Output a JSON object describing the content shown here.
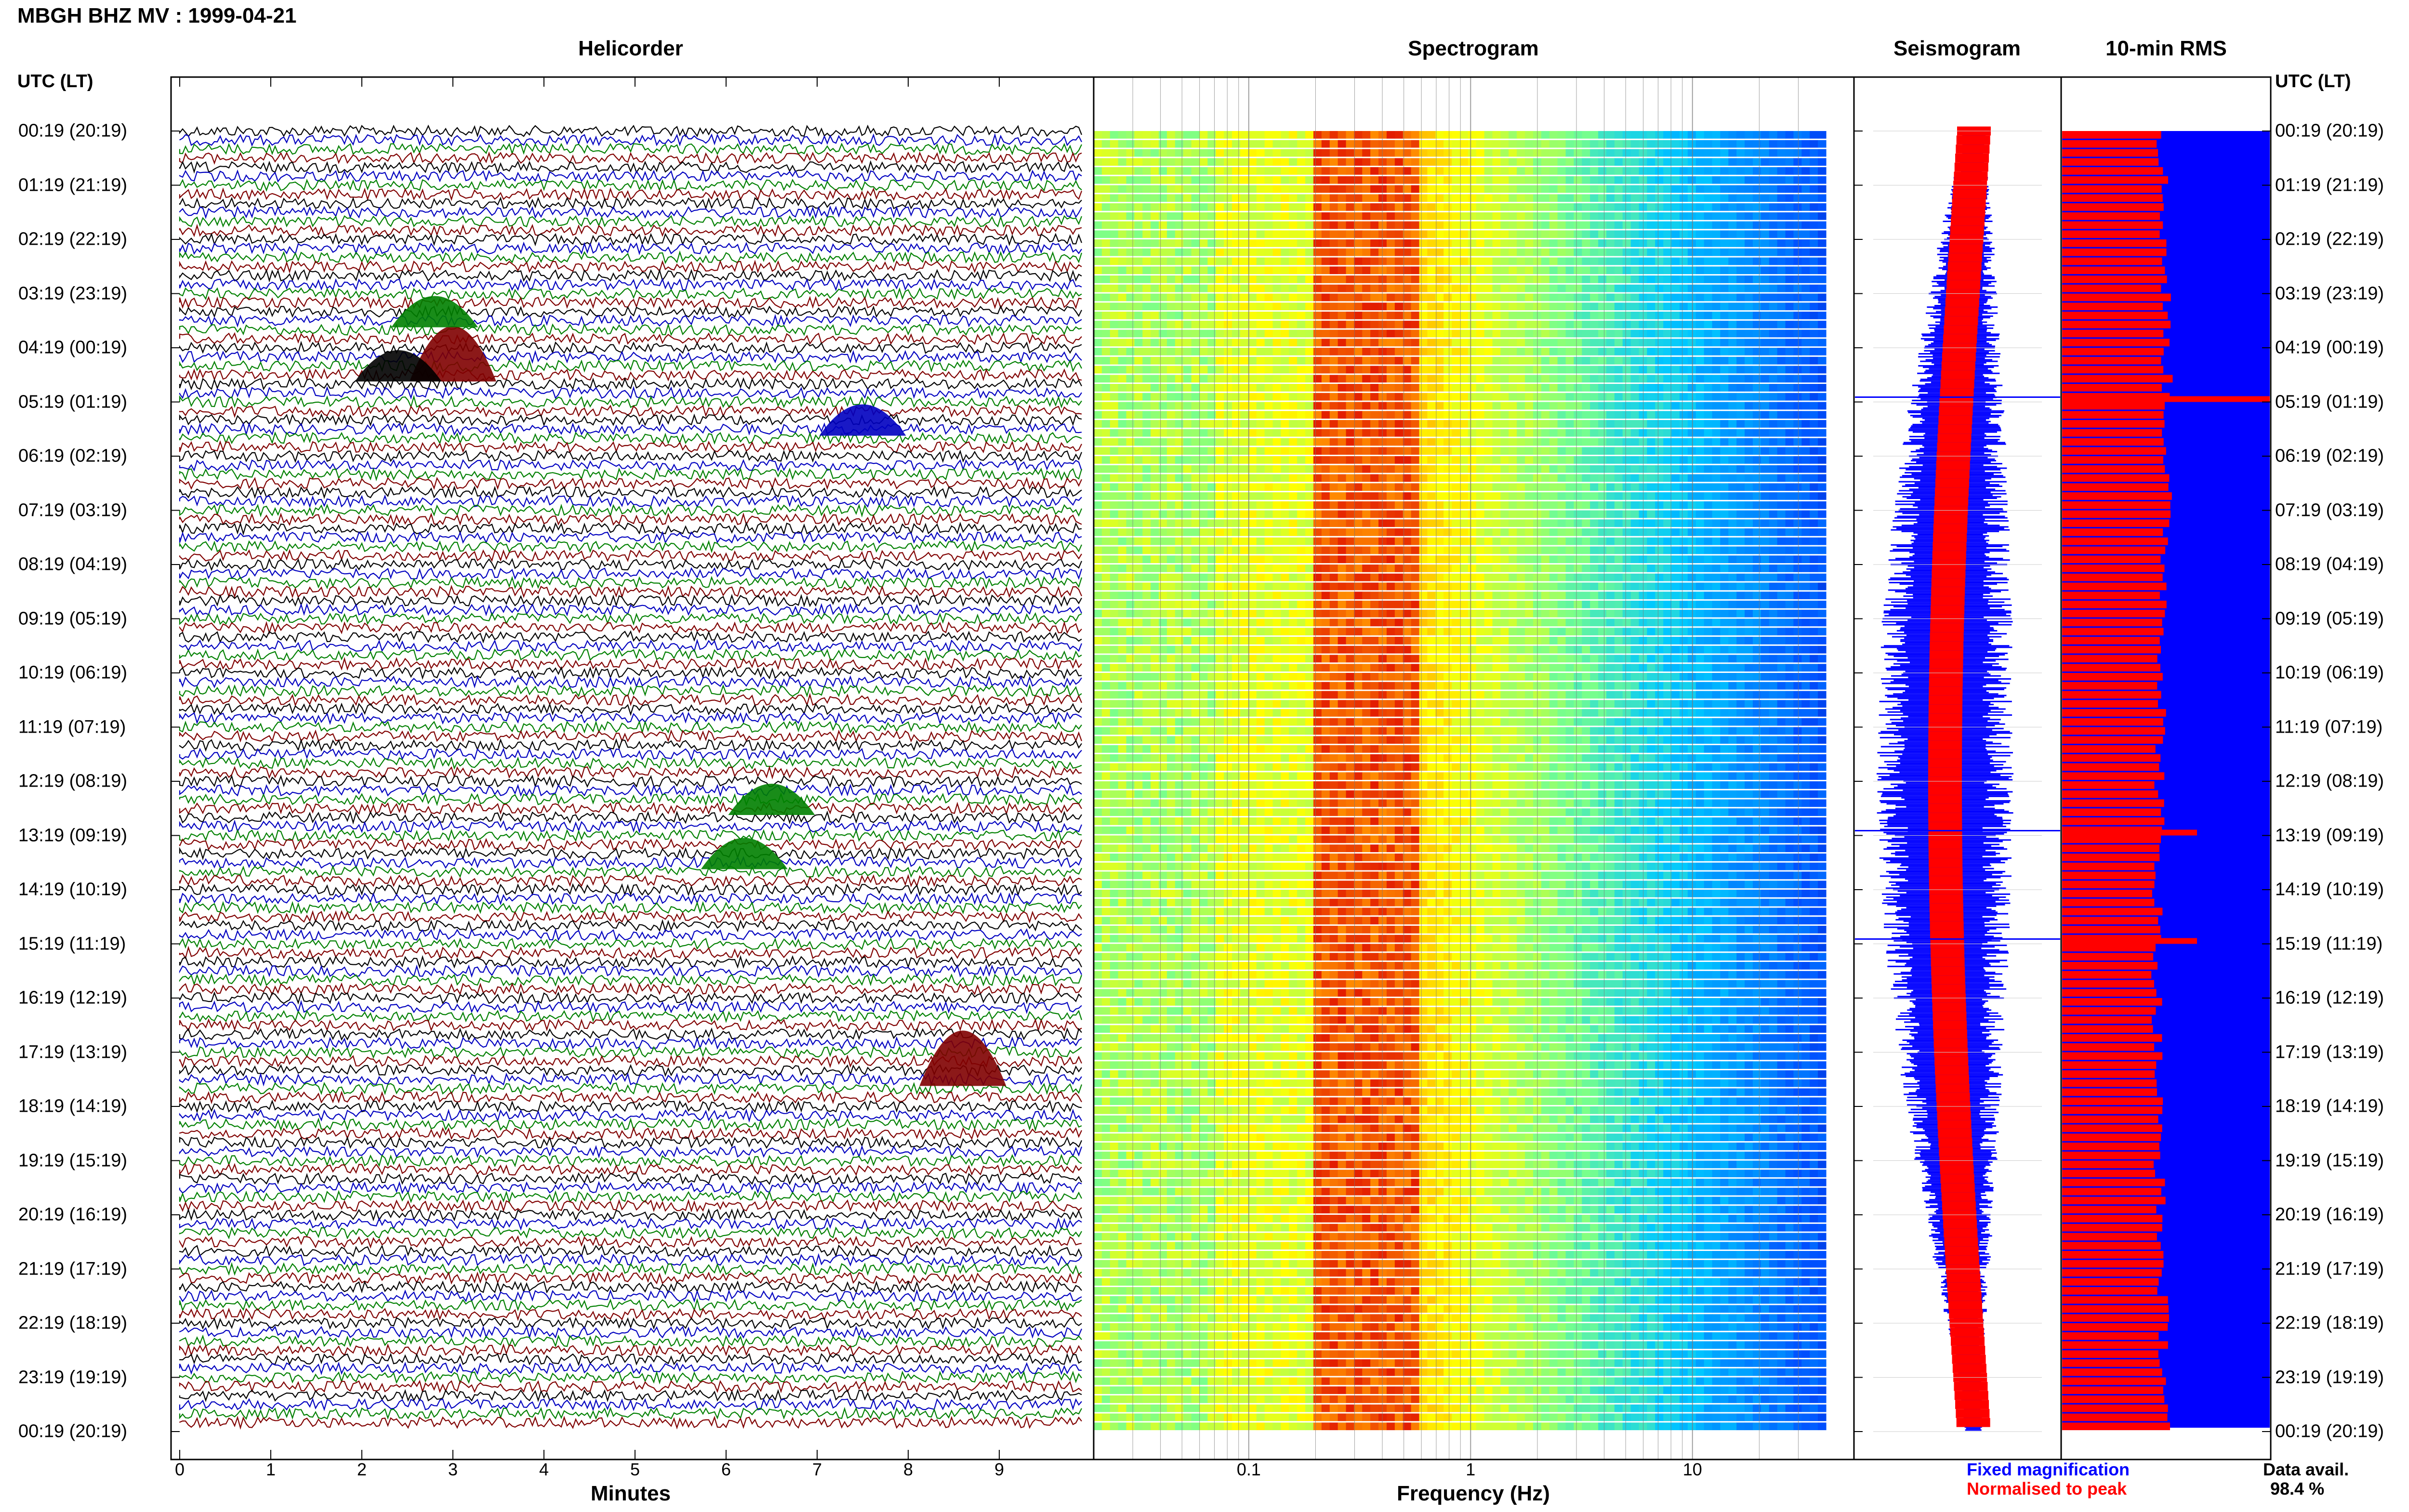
{
  "header": {
    "title": "MBGH BHZ MV : 1999-04-21",
    "utc_label_left": "UTC (LT)",
    "utc_label_right": "UTC (LT)"
  },
  "panels": {
    "helicorder": "Helicorder",
    "spectrogram": "Spectrogram",
    "seismogram": "Seismogram",
    "rms": "10-min RMS"
  },
  "axes": {
    "helicorder_xlabel": "Minutes",
    "spectrogram_xlabel": "Frequency (Hz)"
  },
  "legend": {
    "fixed": "Fixed magnification",
    "normalised": "Normalised to peak",
    "fixed_color": "#0000ff",
    "normalised_color": "#ff0000"
  },
  "availability": {
    "label": "Data avail.",
    "value": "98.4 %"
  },
  "colors": {
    "trace_black": "#000000",
    "trace_green": "#008000",
    "trace_red": "#800000",
    "trace_blue": "#0000c0",
    "rms_blue": "#0000ff",
    "rms_red": "#ff0000"
  },
  "chart_data": [
    {
      "type": "line",
      "panel": "Helicorder",
      "xlabel": "Minutes",
      "xlim": [
        0,
        10
      ],
      "x_ticks": [
        "0",
        "1",
        "2",
        "3",
        "4",
        "5",
        "6",
        "7",
        "8",
        "9"
      ],
      "y_ticks": [
        "00:19 (20:19)",
        "01:19 (21:19)",
        "02:19 (22:19)",
        "03:19 (23:19)",
        "04:19 (00:19)",
        "05:19 (01:19)",
        "06:19 (02:19)",
        "07:19 (03:19)",
        "08:19 (04:19)",
        "09:19 (05:19)",
        "10:19 (06:19)",
        "11:19 (07:19)",
        "12:19 (08:19)",
        "13:19 (09:19)",
        "14:19 (10:19)",
        "15:19 (11:19)",
        "16:19 (12:19)",
        "17:19 (13:19)",
        "18:19 (14:19)",
        "19:19 (15:19)",
        "20:19 (16:19)",
        "21:19 (17:19)",
        "22:19 (18:19)",
        "23:19 (19:19)",
        "00:19 (20:19)"
      ],
      "trace_count": 144,
      "trace_color_cycle": [
        "black",
        "blue",
        "green",
        "red"
      ],
      "events": [
        {
          "time": "04:19",
          "minute": 3.0,
          "color": "red"
        },
        {
          "time": "04:19",
          "minute": 2.4,
          "color": "black"
        },
        {
          "time": "03:19",
          "minute": 2.8,
          "color": "green"
        },
        {
          "time": "05:19",
          "minute": 7.5,
          "color": "blue"
        },
        {
          "time": "12:19",
          "minute": 6.5,
          "color": "green"
        },
        {
          "time": "13:19",
          "minute": 6.2,
          "color": "green"
        },
        {
          "time": "17:19",
          "minute": 8.6,
          "color": "red"
        }
      ]
    },
    {
      "type": "heatmap",
      "panel": "Spectrogram",
      "xlabel": "Frequency (Hz)",
      "x_scale": "log",
      "xlim": [
        0.02,
        40
      ],
      "x_ticks": [
        "0.1",
        "1",
        "10"
      ],
      "peak_band_hz": [
        0.2,
        0.6
      ],
      "rows": 144
    },
    {
      "type": "line",
      "panel": "Seismogram",
      "series": [
        {
          "name": "Fixed magnification",
          "color": "#0000ff"
        },
        {
          "name": "Normalised to peak",
          "color": "#ff0000"
        }
      ],
      "spike_times": [
        "05:19",
        "13:19",
        "15:19"
      ]
    },
    {
      "type": "bar",
      "panel": "10-min RMS",
      "bars": 144,
      "background_series": "#0000ff",
      "bar_color": "#ff0000",
      "spike_times": [
        "05:19",
        "13:19",
        "15:19"
      ]
    }
  ]
}
